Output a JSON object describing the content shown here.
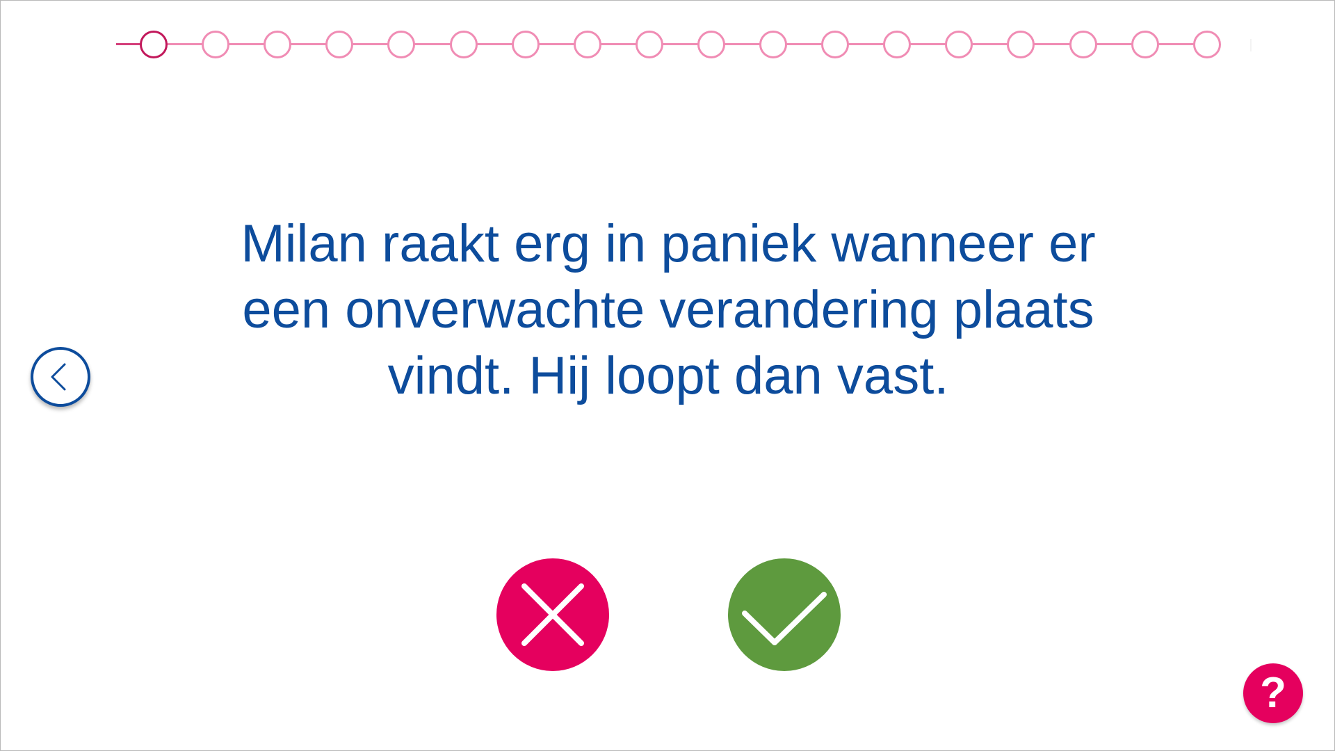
{
  "progress": {
    "total_steps": 18,
    "current_step": 1
  },
  "statement": {
    "text": "Milan raakt erg in paniek wanneer er een onverwachte verandering plaats vindt. Hij loopt dan vast."
  },
  "navigation": {
    "back_icon": "chevron-left-icon"
  },
  "answers": {
    "no_icon": "cross-icon",
    "yes_icon": "check-icon"
  },
  "help": {
    "label": "?"
  },
  "colors": {
    "text_primary": "#0d4c9c",
    "accent_pink": "#e5005e",
    "track_pink": "#f08cb4",
    "current_step": "#c2185b",
    "confirm_green": "#5e9a3e"
  }
}
